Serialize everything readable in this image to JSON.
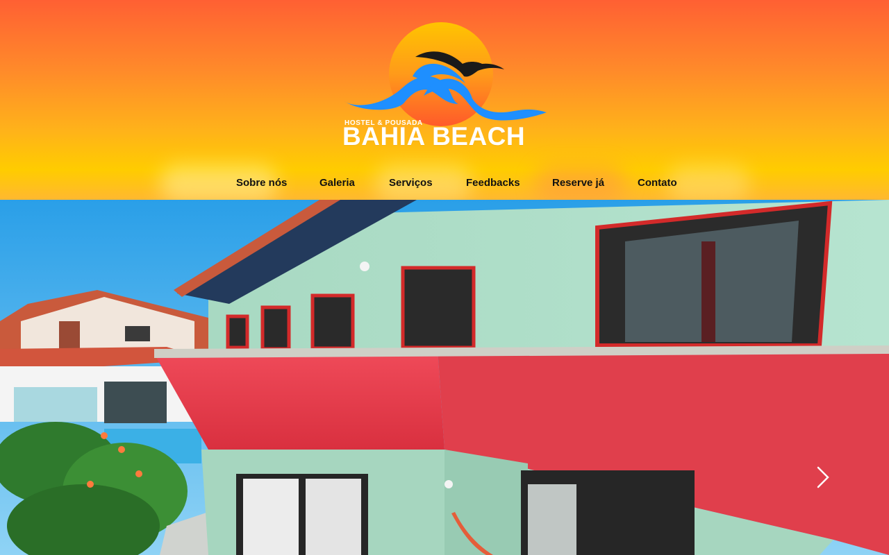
{
  "logo": {
    "tagline": "HOSTEL & POUSADA",
    "brand": "BAHIA BEACH",
    "icon": "sun-seagull-wave-logo"
  },
  "nav": {
    "items": [
      {
        "label": "Sobre nós"
      },
      {
        "label": "Galeria"
      },
      {
        "label": "Serviços"
      },
      {
        "label": "Feedbacks"
      },
      {
        "label": "Reserve já"
      },
      {
        "label": "Contato"
      }
    ]
  },
  "hero": {
    "image": "hostel-building-photo",
    "next_icon": "chevron-right-icon"
  },
  "colors": {
    "header_top": "#ff6033",
    "header_bottom": "#ffcc00",
    "wave_blue": "#1e8fff",
    "bird_black": "#1a1a1a",
    "wall_red": "#e8414f",
    "wall_green": "#a9dcc5"
  }
}
